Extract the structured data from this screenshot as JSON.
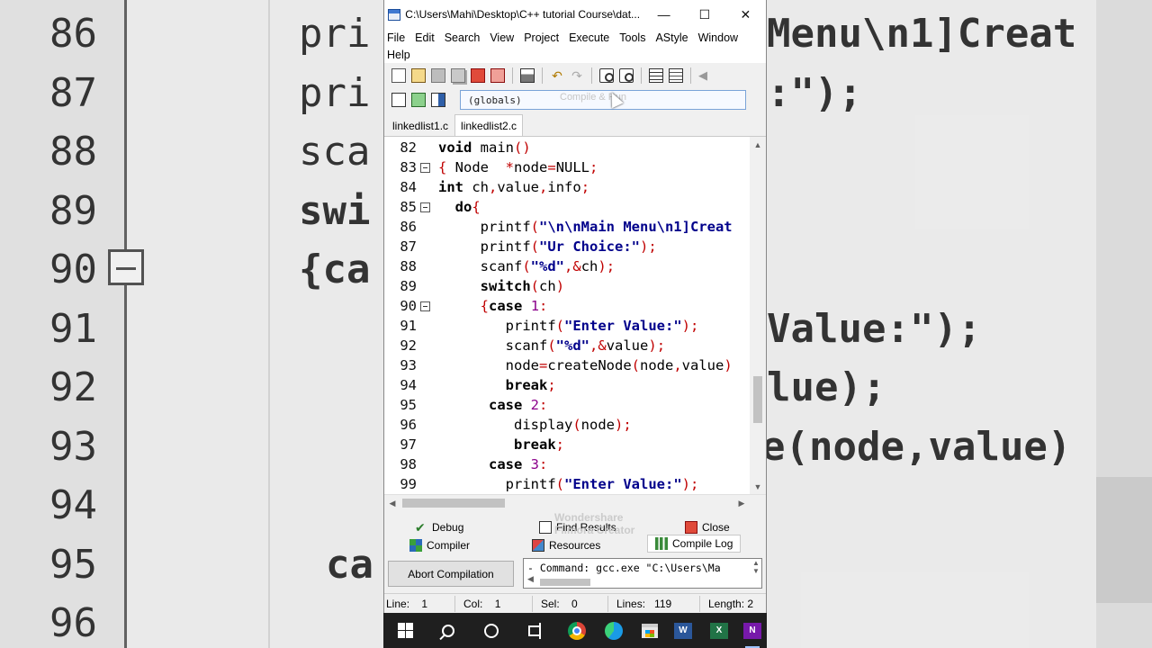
{
  "window": {
    "title": "C:\\Users\\Mahi\\Desktop\\C++ tutorial Course\\dat...",
    "controls": {
      "minimize": "—",
      "maximize": "☐",
      "close": "✕"
    }
  },
  "menu": {
    "row1": [
      "File",
      "Edit",
      "Search",
      "View",
      "Project",
      "Execute",
      "Tools",
      "AStyle",
      "Window"
    ],
    "row2": [
      "Help"
    ]
  },
  "toolbar": {
    "globals": "(globals)",
    "ghost_tooltip": "Compile & Run"
  },
  "tabs": [
    {
      "label": "linkedlist1.c",
      "active": false
    },
    {
      "label": "linkedlist2.c",
      "active": true
    }
  ],
  "editor": {
    "line_numbers": [
      "82",
      "83",
      "84",
      "85",
      "86",
      "87",
      "88",
      "89",
      "90",
      "91",
      "92",
      "93",
      "94",
      "95",
      "96",
      "97",
      "98",
      "99"
    ],
    "lines": [
      "void main()",
      "{ Node  *node=NULL;",
      "int ch,value,info;",
      "  do{",
      "     printf(\"\\n\\nMain Menu\\n1]Creat",
      "     printf(\"Ur Choice:\");",
      "     scanf(\"%d\",&ch);",
      "     switch(ch)",
      "     {case 1:",
      "        printf(\"Enter Value:\");",
      "        scanf(\"%d\",&value);",
      "        node=createNode(node,value)",
      "        break;",
      "      case 2:",
      "         display(node);",
      "         break;",
      "      case 3:",
      "        printf(\"Enter Value:\");"
    ],
    "fold_lines": [
      "83",
      "85",
      "90"
    ]
  },
  "background": {
    "line_numbers": [
      "86",
      "87",
      "88",
      "89",
      "90",
      "91",
      "92",
      "93",
      "94",
      "95",
      "96"
    ],
    "left_code": [
      "pri",
      "pri",
      "sca",
      "swi",
      "{ca",
      "",
      "",
      "",
      "",
      "ca",
      ""
    ],
    "right_code": [
      "Menu\\n1]Creat",
      ":\");",
      "",
      "",
      "",
      "Value:\");",
      "lue);",
      "e(node,value)",
      "",
      "",
      ""
    ]
  },
  "bottom_panel": {
    "tabs": {
      "debug": "Debug",
      "find_results": "Find Results",
      "close": "Close",
      "compiler": "Compiler",
      "resources": "Resources",
      "compile_log": "Compile Log"
    },
    "watermark_line1": "Wondershare",
    "watermark_line2": "Filmora Creator",
    "abort_button": "Abort Compilation",
    "log_text": "- Command: gcc.exe \"C:\\Users\\Ma"
  },
  "statusbar": {
    "line_label": "Line:",
    "line_value": "1",
    "col_label": "Col:",
    "col_value": "1",
    "sel_label": "Sel:",
    "sel_value": "0",
    "lines_label": "Lines:",
    "lines_value": "119",
    "length_label": "Length:",
    "length_value": "2"
  },
  "taskbar": {
    "word": "W",
    "excel": "X",
    "onenote": "N"
  },
  "colors": {
    "keyword": "#000000",
    "string": "#00008b",
    "number": "#8b008b",
    "symbol": "#c00000",
    "taskbar": "#1f1f1f"
  }
}
